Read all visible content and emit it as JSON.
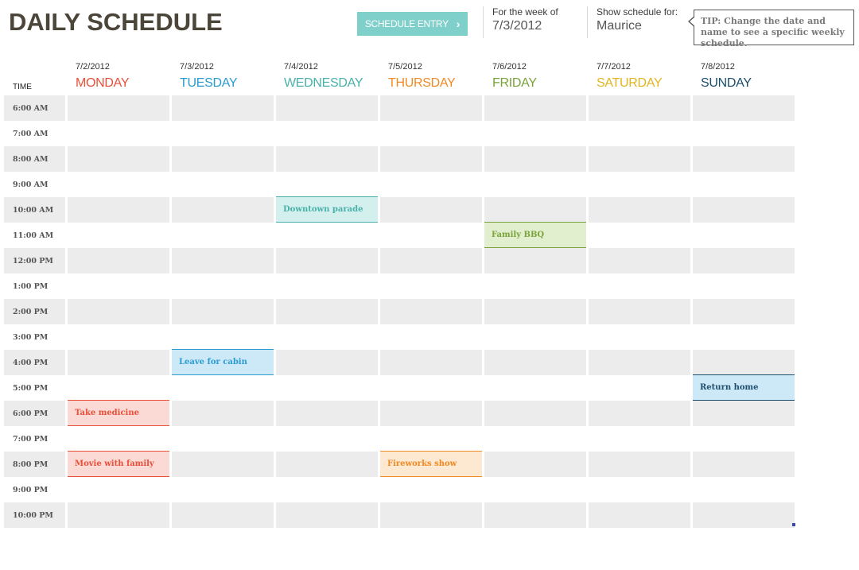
{
  "header": {
    "title": "DAILY SCHEDULE",
    "entry_button": {
      "label": "SCHEDULE ENTRY",
      "icon": "chevron-right-icon"
    },
    "week_label": "For the week of",
    "week_value": "7/3/2012",
    "person_label": "Show schedule for:",
    "person_value": "Maurice",
    "tip": "TIP: Change the date and name to see a specific weekly schedule."
  },
  "grid": {
    "time_header": "TIME",
    "days": [
      {
        "date": "7/2/2012",
        "name": "MONDAY",
        "color": "#e8503a"
      },
      {
        "date": "7/3/2012",
        "name": "TUESDAY",
        "color": "#2a9bd1"
      },
      {
        "date": "7/4/2012",
        "name": "WEDNESDAY",
        "color": "#4ab1aa"
      },
      {
        "date": "7/5/2012",
        "name": "THURSDAY",
        "color": "#f08a24"
      },
      {
        "date": "7/6/2012",
        "name": "FRIDAY",
        "color": "#79a33a"
      },
      {
        "date": "7/7/2012",
        "name": "SATURDAY",
        "color": "#e0b520"
      },
      {
        "date": "7/8/2012",
        "name": "SUNDAY",
        "color": "#1d4e6e"
      }
    ],
    "times": [
      "6:00 AM",
      "7:00 AM",
      "8:00 AM",
      "9:00 AM",
      "10:00 AM",
      "11:00 AM",
      "12:00 PM",
      "1:00 PM",
      "2:00 PM",
      "3:00 PM",
      "4:00 PM",
      "5:00 PM",
      "6:00 PM",
      "7:00 PM",
      "8:00 PM",
      "9:00 PM",
      "10:00 PM"
    ]
  },
  "events": [
    {
      "day": 2,
      "time": 4,
      "label": "Downtown parade",
      "bg": "#d3f0ee",
      "border": "#4ab1aa",
      "color": "#4ab1aa"
    },
    {
      "day": 4,
      "time": 5,
      "label": "Family BBQ",
      "bg": "#e2efce",
      "border": "#79a33a",
      "color": "#79a33a"
    },
    {
      "day": 1,
      "time": 10,
      "label": "Leave for cabin",
      "bg": "#cde9f7",
      "border": "#2a9bd1",
      "color": "#2a9bd1"
    },
    {
      "day": 6,
      "time": 11,
      "label": "Return home",
      "bg": "#cde9f7",
      "border": "#1d4e6e",
      "color": "#1d4e6e"
    },
    {
      "day": 0,
      "time": 12,
      "label": "Take medicine",
      "bg": "#fbd9d4",
      "border": "#e8503a",
      "color": "#e8503a"
    },
    {
      "day": 0,
      "time": 14,
      "label": "Movie with family",
      "bg": "#fbd9d4",
      "border": "#e8503a",
      "color": "#e8503a"
    },
    {
      "day": 3,
      "time": 14,
      "label": "Fireworks show",
      "bg": "#fde8d2",
      "border": "#f08a24",
      "color": "#f08a24"
    }
  ]
}
